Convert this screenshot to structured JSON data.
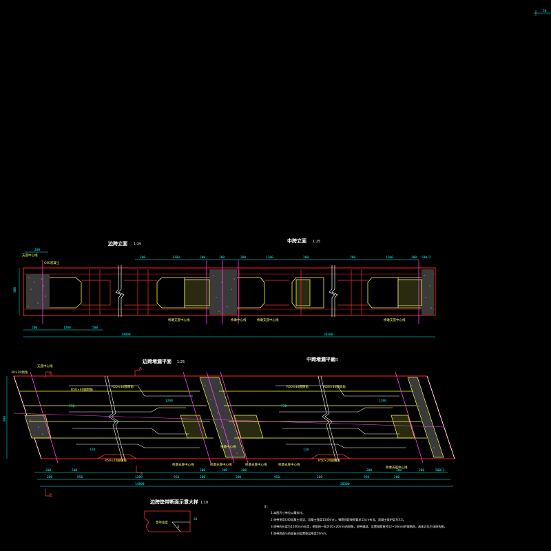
{
  "corner_label": "50",
  "elev_side": {
    "title": "边跨立面",
    "scale": "1:25"
  },
  "elev_mid": {
    "title": "中跨立面",
    "scale": "1:25"
  },
  "plan_side": {
    "title": "边跨堵漏平面",
    "scale": "1:25"
  },
  "plan_mid": {
    "title": "中跨堵漏平面",
    "scale": "1:25"
  },
  "detail": {
    "title": "边跨垫带断面示意大样",
    "scale": "1:10",
    "label": "垫带宽度",
    "dim": "20",
    "mark": "2"
  },
  "elev_dims_top": [
    "200",
    "200",
    "1200",
    "200",
    "200",
    "200",
    "1200",
    "200",
    "200",
    "1200",
    "200",
    "300",
    "1200",
    "300",
    "500/2"
  ],
  "elev_dims_bottom": [
    "200",
    "1200",
    "500",
    "14800",
    "20300"
  ],
  "elev_left_dim": "500",
  "elev_labels": [
    "支座中心线",
    "C40混凝土",
    "桥墩支座中心线",
    "桥墩中心线",
    "桥墩支座中心线",
    "桥墩支座中心线"
  ],
  "plan_labels": [
    "30×30倒角",
    "R50×40圆倒角",
    "R50×40圆倒角",
    "R50×40圆倒角",
    "R50×40圆倒角",
    "R50×20圆倒角",
    "R50×20圆倒角",
    "桥墩支座中心线",
    "桥墩支座中心线",
    "桥墩中心线",
    "桥墩支座中心线",
    "桥墩支座中心线",
    "桥墩支座中心线",
    "支座中心线"
  ],
  "plan_small_dims": [
    "770",
    "770",
    "120",
    "120",
    "1200",
    "1200"
  ],
  "plan_left_dim": "900",
  "plan_dims_row1": [
    "200",
    "500",
    "200",
    "300",
    "200",
    "200",
    "300",
    "200",
    "500/2"
  ],
  "plan_dims_row2": [
    "200",
    "950",
    "1200",
    "950",
    "200",
    "200",
    "950",
    "200",
    "950",
    "200"
  ],
  "plan_dims_total": [
    "14800",
    "20300"
  ],
  "section_marks": [
    "A",
    "A",
    "B",
    "B"
  ],
  "notes": {
    "heading": "注：",
    "items": [
      "1.本图尺寸单位以毫米计。",
      "2.垫带采用C40混凝土现浇，混凝土强度1500mm，钢筋间距按照要求15cm布设，混凝土保护层为3.5。",
      "3.垫带的长度为1200mm长度，倒角按一般为30×20mm的倒角，垫带端部，设置钢筋直径12~16mm的钢筋网，具体详见主体结构图。",
      "4.垫带底面与桥面板间设置垫层厚度50mm。"
    ]
  }
}
